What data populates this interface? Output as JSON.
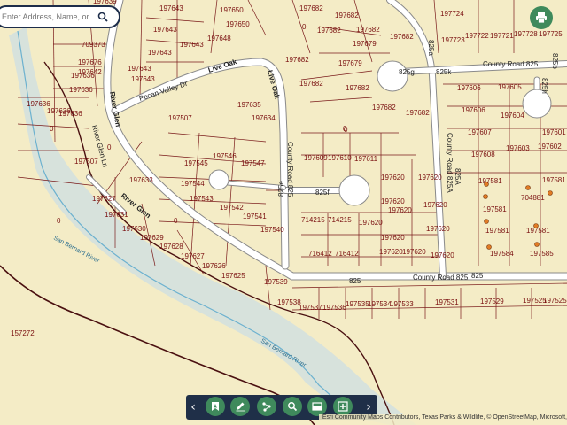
{
  "search": {
    "placeholder": "Enter Address, Name, or ID"
  },
  "parcels": {
    "r1": [
      "197639",
      "197643",
      "197650",
      "197682",
      "197682",
      "197724"
    ],
    "r2": [
      "197643",
      "197643",
      "197648",
      "197650",
      "0",
      "197682",
      "197682"
    ],
    "r3": [
      "709373",
      "197676",
      "197643",
      "197679",
      "197682",
      "197722",
      "197721",
      "197728",
      "197725"
    ],
    "r4": [
      "197636",
      "197642",
      "197643",
      "197679",
      "197682",
      "197723"
    ],
    "r5": [
      "197636",
      "197636",
      "197643",
      "197682",
      "197682"
    ],
    "r6": [
      "197636",
      "197606",
      "197605"
    ],
    "r7": [
      "197636",
      "197635",
      "197634",
      "197682",
      "197682",
      "197604"
    ],
    "r8": [
      "197507",
      "197606",
      "197607",
      "197602",
      "197601"
    ],
    "r9": [
      "0",
      "0",
      "197609",
      "197610",
      "197611",
      "197603",
      "197608"
    ],
    "r10": [
      "197507",
      "197545",
      "197546",
      "197547",
      "197620",
      "197620",
      "197581",
      "197581"
    ],
    "r11": [
      "197633",
      "197544",
      "197620",
      "704881"
    ],
    "r12": [
      "197627",
      "197543",
      "197542",
      "197620",
      "197620",
      "197581"
    ],
    "r13": [
      "197631",
      "197541",
      "714215",
      "714215",
      "197620",
      "197620"
    ],
    "r14": [
      "0",
      "0",
      "197630",
      "197629",
      "197540",
      "197620",
      "197581",
      "197581"
    ],
    "r15": [
      "197628",
      "716412",
      "716412",
      "197620",
      "197620",
      "197620",
      "197584",
      "197585"
    ],
    "r16": [
      "197627",
      "197626",
      "197625",
      "0"
    ],
    "r17": [
      "197539",
      "197538",
      "197537",
      "197536",
      "197535",
      "197534",
      "197533",
      "197531",
      "197529",
      "197525",
      "197525"
    ],
    "r18": [
      "157272",
      "0"
    ]
  },
  "roads": {
    "county_rd_825": "County Road 825",
    "n825": "825",
    "n825b": "825",
    "cr825_vertical": "County Road 825",
    "n825f": "825f",
    "n825g": "825g",
    "n825k": "825k",
    "n825h": "825h",
    "n825a": "825a",
    "cr825a": "County Road 825A",
    "n825a2": "825A",
    "n825e": "825e",
    "cr825_top": "County Road 825",
    "live_oak_1": "Live Oak",
    "live_oak_2": "Live Oak",
    "pecan_valley": "Pecan Valley Dr",
    "river_glen_1": "River Glen",
    "river_glen_2": "River Glen",
    "river_glen_3": "River Glen Ln",
    "n825b_top": "825b"
  },
  "rivers": {
    "river_1": "San Bernard River",
    "river_2": "San Bernard River"
  },
  "attribution": "Esri Community Maps Contributors, Texas Parks & Wildlife, © OpenStreetMap, Microsoft,",
  "toolbar": {
    "prev": "‹",
    "next": "›",
    "tools": [
      "bookmark-icon",
      "draw-pencil-icon",
      "measure-icon",
      "search-map-icon",
      "basemap-icon",
      "add-data-icon"
    ]
  },
  "colors": {
    "background": "#f4ecc6",
    "parcel_line": "#7a1a1a",
    "parcel_text": "#7a1010",
    "river_fill": "#d7e2dc",
    "river_line": "#6cb1cf",
    "road": "#ffffff",
    "toolbar": "#1f2f48",
    "button_green": "#3f8a5c",
    "point_orange": "#e07b24"
  }
}
